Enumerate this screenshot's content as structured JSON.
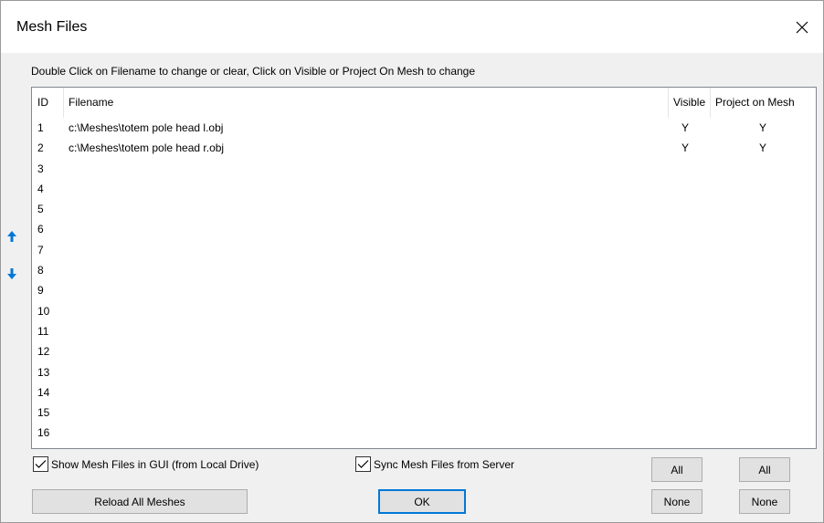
{
  "window": {
    "title": "Mesh Files"
  },
  "instruction": "Double Click on Filename to change or clear, Click on Visible or Project On Mesh to change",
  "table": {
    "headers": {
      "id": "ID",
      "filename": "Filename",
      "visible": "Visible",
      "project": "Project on Mesh"
    },
    "rows": [
      {
        "id": "1",
        "filename": "c:\\Meshes\\totem pole head l.obj",
        "visible": "Y",
        "project": "Y"
      },
      {
        "id": "2",
        "filename": "c:\\Meshes\\totem pole head r.obj",
        "visible": "Y",
        "project": "Y"
      },
      {
        "id": "3",
        "filename": "",
        "visible": "",
        "project": ""
      },
      {
        "id": "4",
        "filename": "",
        "visible": "",
        "project": ""
      },
      {
        "id": "5",
        "filename": "",
        "visible": "",
        "project": ""
      },
      {
        "id": "6",
        "filename": "",
        "visible": "",
        "project": ""
      },
      {
        "id": "7",
        "filename": "",
        "visible": "",
        "project": ""
      },
      {
        "id": "8",
        "filename": "",
        "visible": "",
        "project": ""
      },
      {
        "id": "9",
        "filename": "",
        "visible": "",
        "project": ""
      },
      {
        "id": "10",
        "filename": "",
        "visible": "",
        "project": ""
      },
      {
        "id": "11",
        "filename": "",
        "visible": "",
        "project": ""
      },
      {
        "id": "12",
        "filename": "",
        "visible": "",
        "project": ""
      },
      {
        "id": "13",
        "filename": "",
        "visible": "",
        "project": ""
      },
      {
        "id": "14",
        "filename": "",
        "visible": "",
        "project": ""
      },
      {
        "id": "15",
        "filename": "",
        "visible": "",
        "project": ""
      },
      {
        "id": "16",
        "filename": "",
        "visible": "",
        "project": ""
      }
    ]
  },
  "side_controls": {
    "up_icon": "arrow-up-icon",
    "down_icon": "arrow-down-icon",
    "accent_color": "#0078d7"
  },
  "checkboxes": {
    "show_mesh": {
      "label": "Show Mesh Files in GUI (from Local Drive)",
      "checked": true
    },
    "sync_mesh": {
      "label": "Sync Mesh Files from Server",
      "checked": true
    }
  },
  "buttons": {
    "reload": "Reload All Meshes",
    "ok": "OK",
    "visible_all": "All",
    "visible_none": "None",
    "project_all": "All",
    "project_none": "None"
  }
}
